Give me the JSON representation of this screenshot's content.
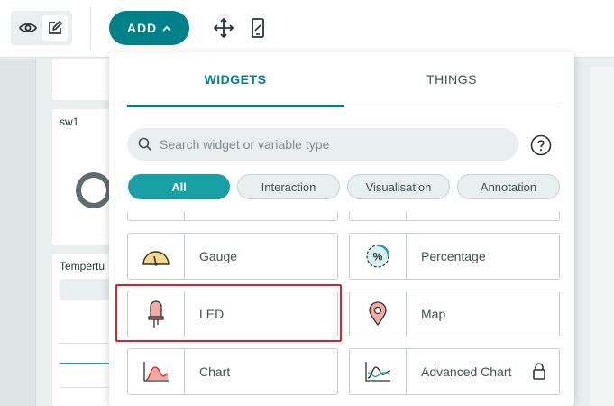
{
  "toolbar": {
    "add_label": "ADD"
  },
  "dashboard": {
    "switch_card_title": "sw1",
    "temp_card_title": "Tempertu"
  },
  "picker": {
    "tabs": [
      {
        "label": "WIDGETS",
        "active": true
      },
      {
        "label": "THINGS",
        "active": false
      }
    ],
    "search_placeholder": "Search widget or variable type",
    "filters": [
      {
        "label": "All",
        "active": true
      },
      {
        "label": "Interaction",
        "active": false
      },
      {
        "label": "Visualisation",
        "active": false
      },
      {
        "label": "Annotation",
        "active": false
      }
    ],
    "widgets": [
      {
        "label": "Gauge",
        "icon": "gauge-icon"
      },
      {
        "label": "Percentage",
        "icon": "percentage-icon"
      },
      {
        "label": "LED",
        "icon": "led-icon",
        "highlighted": true
      },
      {
        "label": "Map",
        "icon": "map-pin-icon"
      },
      {
        "label": "Chart",
        "icon": "chart-icon"
      },
      {
        "label": "Advanced Chart",
        "icon": "advanced-chart-icon",
        "locked": true
      }
    ],
    "percentage_symbol": "%"
  },
  "colors": {
    "accent": "#00818a",
    "filter_active": "#17a0a6",
    "highlight": "#d9222a",
    "text": "#434f54"
  }
}
